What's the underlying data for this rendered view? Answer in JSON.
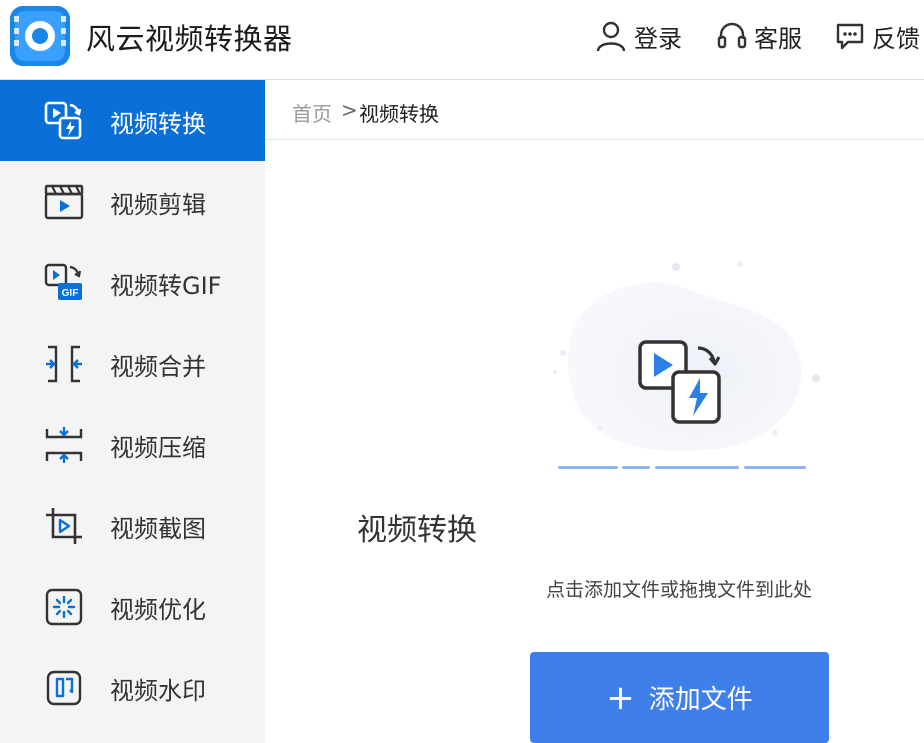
{
  "app": {
    "title": "风云视频转换器"
  },
  "header": {
    "login_label": "登录",
    "service_label": "客服",
    "feedback_label": "反馈"
  },
  "sidebar": {
    "items": [
      {
        "label": "视频转换",
        "icon": "video-convert-icon",
        "active": true
      },
      {
        "label": "视频剪辑",
        "icon": "clapperboard-icon"
      },
      {
        "label": "视频转GIF",
        "icon": "gif-icon"
      },
      {
        "label": "视频合并",
        "icon": "merge-icon"
      },
      {
        "label": "视频压缩",
        "icon": "compress-icon"
      },
      {
        "label": "视频截图",
        "icon": "crop-icon"
      },
      {
        "label": "视频优化",
        "icon": "sparkle-icon"
      },
      {
        "label": "视频水印",
        "icon": "seal-icon"
      }
    ]
  },
  "breadcrumb": {
    "home": "首页",
    "separator": ">",
    "current": "视频转换"
  },
  "main": {
    "title": "视频转换",
    "hint": "点击添加文件或拖拽文件到此处",
    "add_button_label": "添加文件"
  },
  "colors": {
    "accent": "#0a6fd6",
    "button": "#3f7fe9",
    "sidebar_bg": "#f4f4f4"
  }
}
